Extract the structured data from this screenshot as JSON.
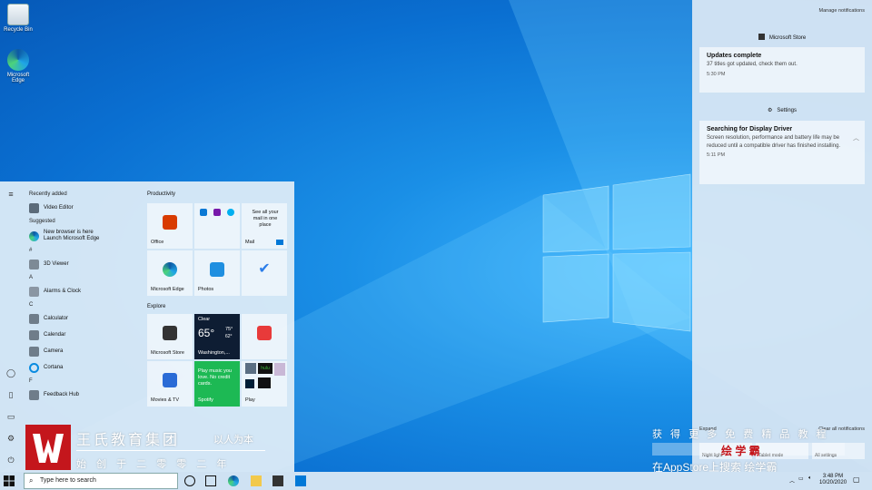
{
  "desktop": {
    "icons": [
      {
        "label": "Recycle Bin",
        "icon": "recycle-bin-icon"
      },
      {
        "label": "Microsoft Edge",
        "icon": "edge-icon"
      }
    ]
  },
  "start_menu": {
    "recently_added_label": "Recently added",
    "suggested_label": "Suggested",
    "apps": {
      "video_editor": "Video Editor",
      "suggest_line1": "New browser is here",
      "suggest_line2": "Launch Microsoft Edge",
      "hash": "#",
      "viewer3d": "3D Viewer",
      "a": "A",
      "alarms": "Alarms & Clock",
      "c": "C",
      "calculator": "Calculator",
      "calendar": "Calendar",
      "camera": "Camera",
      "cortana": "Cortana",
      "f": "F",
      "feedback": "Feedback Hub"
    },
    "productivity_label": "Productivity",
    "explore_label": "Explore",
    "tiles": {
      "office": "Office",
      "mail_text": "See all your mail in one place",
      "mail": "Mail",
      "edge": "Microsoft Edge",
      "photos": "Photos",
      "store": "Microsoft Store",
      "weather_cond": "Clear",
      "weather_temp": "65°",
      "weather_hi": "75°",
      "weather_lo": "62°",
      "weather_city": "Washington,...",
      "spotify_text": "Play music you love. No credit cards.",
      "spotify": "Spotify",
      "movies": "Movies & TV",
      "play": "Play"
    }
  },
  "action_center": {
    "manage": "Manage notifications",
    "store_header": "Microsoft Store",
    "card1": {
      "title": "Updates complete",
      "body": "37 titles got updated, check them out.",
      "time": "5:30 PM"
    },
    "settings_header": "Settings",
    "card2": {
      "title": "Searching for Display Driver",
      "body": "Screen resolution, performance and battery life may be reduced until a compatible driver has finished installing.",
      "time": "5:11 PM"
    },
    "expand": "Expand",
    "clear_all": "Clear all notifications",
    "quick": {
      "night": "Night light",
      "tablet": "Tablet mode",
      "all": "All settings"
    }
  },
  "taskbar": {
    "search_placeholder": "Type here to search",
    "time": "3:48 PM",
    "date": "10/20/2020"
  },
  "watermark": {
    "line1": "王氏教育集团",
    "line1b": "以人为本",
    "line2": "始 创 于 二 零 零 二 年",
    "right1": "获 得 更 多 免 费 精 品 教 程",
    "right_brand": "绘 学 霸",
    "right2": "在AppStore上搜索 绘学霸"
  },
  "colors": {
    "accent": "#0078d7",
    "watermark_red": "#c4161c",
    "spotify": "#1db954"
  }
}
